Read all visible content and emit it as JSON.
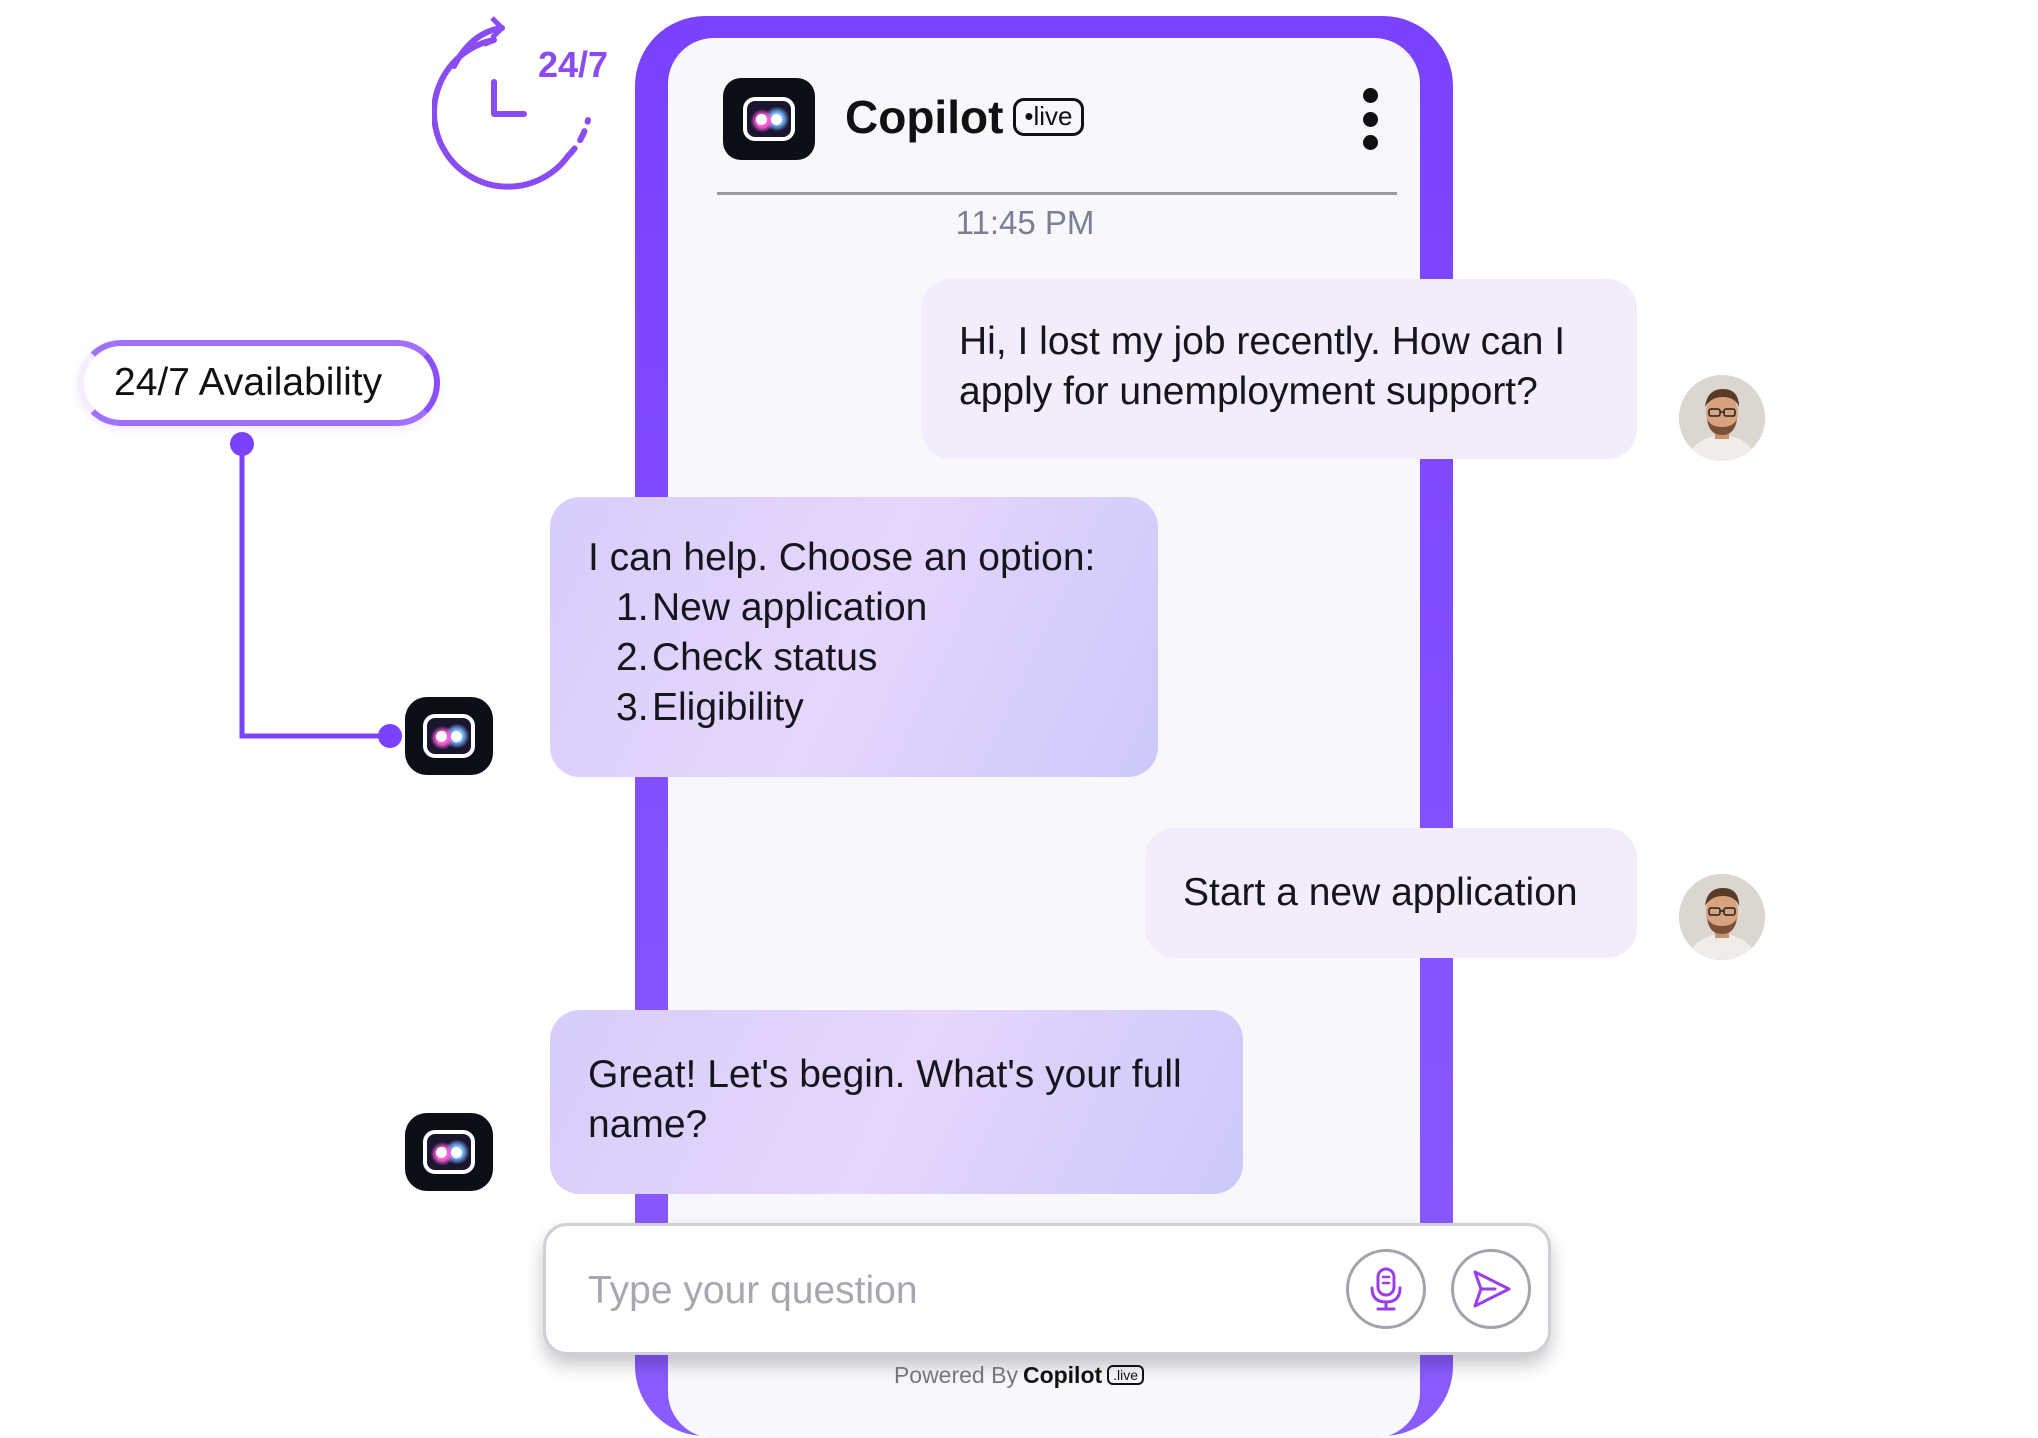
{
  "clock_badge": {
    "text": "24/7",
    "icon": "clock-24-7-icon"
  },
  "feature": {
    "label": "24/7 Availability"
  },
  "header": {
    "app_name": "Copilot",
    "badge": "•live",
    "menu_icon": "more-vertical-icon"
  },
  "chat": {
    "timestamp": "11:45 PM",
    "messages": [
      {
        "sender": "user",
        "text": "Hi, I lost my job recently. How can I apply for unemployment support?"
      },
      {
        "sender": "bot",
        "text": "I can help. Choose an option:",
        "options": [
          {
            "num": "1.",
            "label": "New application"
          },
          {
            "num": "2.",
            "label": "Check status"
          },
          {
            "num": "3.",
            "label": "Eligibility"
          }
        ]
      },
      {
        "sender": "user",
        "text": "Start a new application"
      },
      {
        "sender": "bot",
        "text": "Great! Let's begin. What's your full name?"
      }
    ]
  },
  "input": {
    "placeholder": "Type your question",
    "value": "",
    "mic_icon": "microphone-icon",
    "send_icon": "send-icon"
  },
  "footer": {
    "powered_by": "Powered By",
    "brand": "Copilot",
    "badge": ".live"
  },
  "colors": {
    "accent": "#7a42ff",
    "user_bubble": "#f3ecfc",
    "bot_bubble": "#dcd0fc",
    "logo_bg": "#0d0f18"
  }
}
